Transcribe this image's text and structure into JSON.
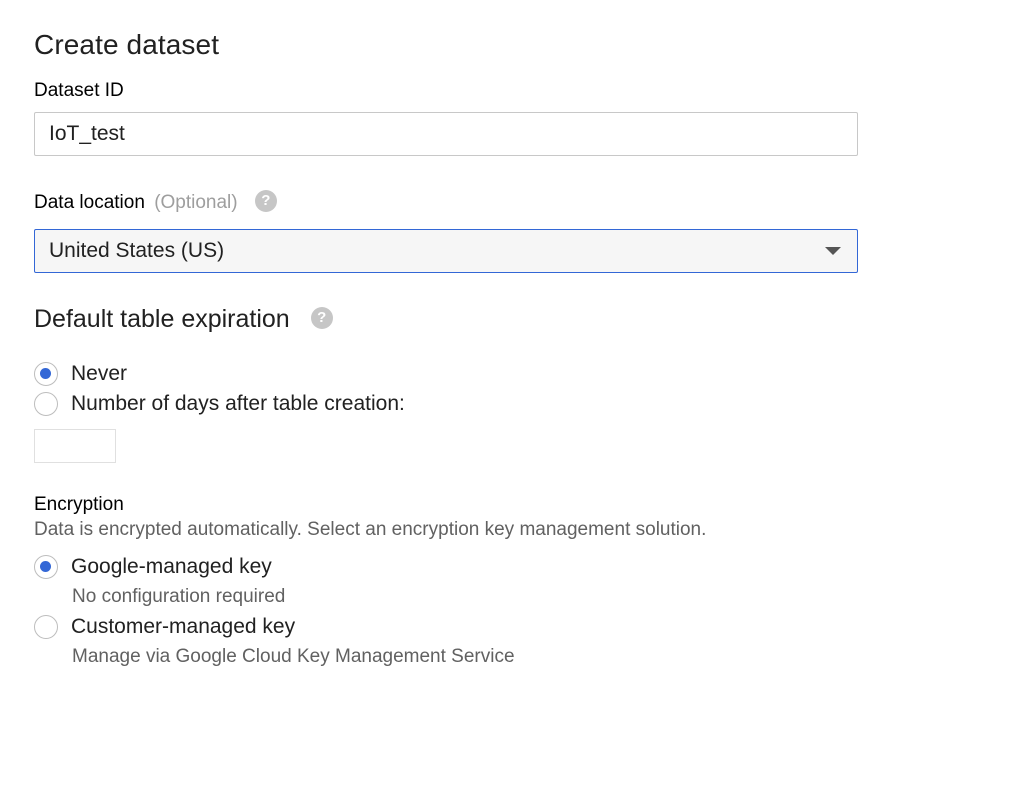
{
  "page": {
    "title": "Create dataset"
  },
  "dataset_id": {
    "label": "Dataset ID",
    "value": "IoT_test"
  },
  "data_location": {
    "label": "Data location",
    "optional": "(Optional)",
    "help_icon": "question-mark-icon",
    "selected": "United States (US)"
  },
  "expiration": {
    "title": "Default table expiration",
    "help_icon": "question-mark-icon",
    "options": [
      {
        "label": "Never",
        "checked": true
      },
      {
        "label": "Number of days after table creation:",
        "checked": false
      }
    ],
    "days_value": ""
  },
  "encryption": {
    "label": "Encryption",
    "description": "Data is encrypted automatically. Select an encryption key management solution.",
    "options": [
      {
        "label": "Google-managed key",
        "sublabel": "No configuration required",
        "checked": true
      },
      {
        "label": "Customer-managed key",
        "sublabel": "Manage via Google Cloud Key Management Service",
        "checked": false
      }
    ]
  },
  "colors": {
    "accent": "#3367d6",
    "help_icon": "#c6c6c6",
    "muted_text": "#616161"
  }
}
